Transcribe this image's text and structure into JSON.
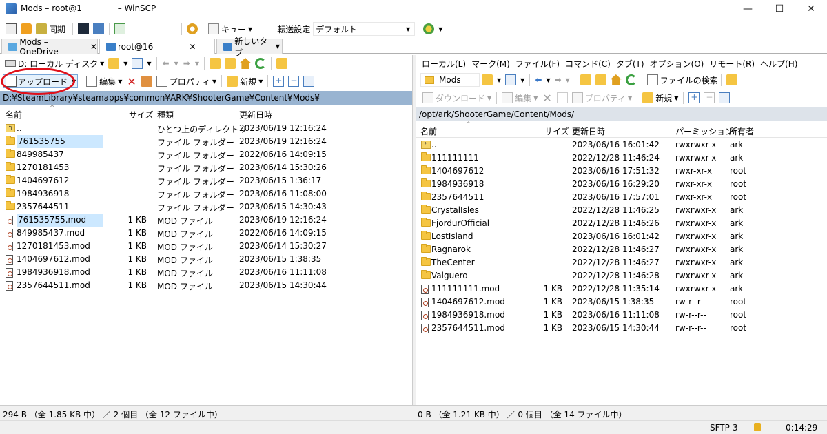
{
  "window": {
    "title": "Mods – root@1     – WinSCP"
  },
  "main_toolbar": {
    "sync_label": "同期",
    "queue_label": "キュー",
    "transfer_settings_label": "転送設定",
    "transfer_preset": "デフォルト"
  },
  "tabs": [
    {
      "label": "Mods – OneDrive"
    },
    {
      "label": "root@16    "
    },
    {
      "label": "新しいタブ"
    }
  ],
  "left": {
    "drive_label": "D: ローカル ディスク",
    "upload_label": "アップロード",
    "edit_label": "編集",
    "properties_label": "プロパティ",
    "new_label": "新規",
    "path": "D:¥SteamLibrary¥steamapps¥common¥ARK¥ShooterGame¥Content¥Mods¥",
    "columns": {
      "name": "名前",
      "size": "サイズ",
      "type": "種類",
      "modified": "更新日時"
    },
    "rows": [
      {
        "name": "..",
        "size": "",
        "type": "ひとつ上のディレクトリ",
        "modified": "2023/06/19 12:16:24",
        "kind": "up",
        "selected": false
      },
      {
        "name": "761535755",
        "size": "",
        "type": "ファイル フォルダー",
        "modified": "2023/06/19 12:16:24",
        "kind": "folder",
        "selected": true
      },
      {
        "name": "849985437",
        "size": "",
        "type": "ファイル フォルダー",
        "modified": "2022/06/16 14:09:15",
        "kind": "folder",
        "selected": false
      },
      {
        "name": "1270181453",
        "size": "",
        "type": "ファイル フォルダー",
        "modified": "2023/06/14 15:30:26",
        "kind": "folder",
        "selected": false
      },
      {
        "name": "1404697612",
        "size": "",
        "type": "ファイル フォルダー",
        "modified": "2023/06/15 1:36:17",
        "kind": "folder",
        "selected": false
      },
      {
        "name": "1984936918",
        "size": "",
        "type": "ファイル フォルダー",
        "modified": "2023/06/16 11:08:00",
        "kind": "folder",
        "selected": false
      },
      {
        "name": "2357644511",
        "size": "",
        "type": "ファイル フォルダー",
        "modified": "2023/06/15 14:30:43",
        "kind": "folder",
        "selected": false
      },
      {
        "name": "761535755.mod",
        "size": "1 KB",
        "type": "MOD ファイル",
        "modified": "2023/06/19 12:16:24",
        "kind": "file",
        "selected": true
      },
      {
        "name": "849985437.mod",
        "size": "1 KB",
        "type": "MOD ファイル",
        "modified": "2022/06/16 14:09:15",
        "kind": "file",
        "selected": false
      },
      {
        "name": "1270181453.mod",
        "size": "1 KB",
        "type": "MOD ファイル",
        "modified": "2023/06/14 15:30:27",
        "kind": "file",
        "selected": false
      },
      {
        "name": "1404697612.mod",
        "size": "1 KB",
        "type": "MOD ファイル",
        "modified": "2023/06/15 1:38:35",
        "kind": "file",
        "selected": false
      },
      {
        "name": "1984936918.mod",
        "size": "1 KB",
        "type": "MOD ファイル",
        "modified": "2023/06/16 11:11:08",
        "kind": "file",
        "selected": false
      },
      {
        "name": "2357644511.mod",
        "size": "1 KB",
        "type": "MOD ファイル",
        "modified": "2023/06/15 14:30:44",
        "kind": "file",
        "selected": false
      }
    ],
    "status": "294 B （全 1.85 KB 中） ／ 2 個目 （全 12 ファイル中）"
  },
  "right": {
    "menu": [
      "ローカル(L)",
      "マーク(M)",
      "ファイル(F)",
      "コマンド(C)",
      "タブ(T)",
      "オプション(O)",
      "リモート(R)",
      "ヘルプ(H)"
    ],
    "folder_label": "Mods",
    "find_label": "ファイルの検索",
    "download_label": "ダウンロード",
    "edit_label": "編集",
    "properties_label": "プロパティ",
    "new_label": "新規",
    "path": "/opt/ark/ShooterGame/Content/Mods/",
    "columns": {
      "name": "名前",
      "size": "サイズ",
      "modified": "更新日時",
      "permissions": "パーミッション",
      "owner": "所有者"
    },
    "rows": [
      {
        "name": "..",
        "size": "",
        "modified": "2023/06/16 16:01:42",
        "perm": "rwxrwxr-x",
        "owner": "ark",
        "kind": "up"
      },
      {
        "name": "111111111",
        "size": "",
        "modified": "2022/12/28 11:46:24",
        "perm": "rwxrwxr-x",
        "owner": "ark",
        "kind": "folder"
      },
      {
        "name": "1404697612",
        "size": "",
        "modified": "2023/06/16 17:51:32",
        "perm": "rwxr-xr-x",
        "owner": "root",
        "kind": "folder"
      },
      {
        "name": "1984936918",
        "size": "",
        "modified": "2023/06/16 16:29:20",
        "perm": "rwxr-xr-x",
        "owner": "root",
        "kind": "folder"
      },
      {
        "name": "2357644511",
        "size": "",
        "modified": "2023/06/16 17:57:01",
        "perm": "rwxr-xr-x",
        "owner": "root",
        "kind": "folder"
      },
      {
        "name": "CrystalIsles",
        "size": "",
        "modified": "2022/12/28 11:46:25",
        "perm": "rwxrwxr-x",
        "owner": "ark",
        "kind": "folder"
      },
      {
        "name": "FjordurOfficial",
        "size": "",
        "modified": "2022/12/28 11:46:26",
        "perm": "rwxrwxr-x",
        "owner": "ark",
        "kind": "folder"
      },
      {
        "name": "LostIsland",
        "size": "",
        "modified": "2023/06/16 16:01:42",
        "perm": "rwxrwxr-x",
        "owner": "ark",
        "kind": "folder"
      },
      {
        "name": "Ragnarok",
        "size": "",
        "modified": "2022/12/28 11:46:27",
        "perm": "rwxrwxr-x",
        "owner": "ark",
        "kind": "folder"
      },
      {
        "name": "TheCenter",
        "size": "",
        "modified": "2022/12/28 11:46:27",
        "perm": "rwxrwxr-x",
        "owner": "ark",
        "kind": "folder"
      },
      {
        "name": "Valguero",
        "size": "",
        "modified": "2022/12/28 11:46:28",
        "perm": "rwxrwxr-x",
        "owner": "ark",
        "kind": "folder"
      },
      {
        "name": "111111111.mod",
        "size": "1 KB",
        "modified": "2022/12/28 11:35:14",
        "perm": "rwxrwxr-x",
        "owner": "ark",
        "kind": "file"
      },
      {
        "name": "1404697612.mod",
        "size": "1 KB",
        "modified": "2023/06/15 1:38:35",
        "perm": "rw-r--r--",
        "owner": "root",
        "kind": "file"
      },
      {
        "name": "1984936918.mod",
        "size": "1 KB",
        "modified": "2023/06/16 11:11:08",
        "perm": "rw-r--r--",
        "owner": "root",
        "kind": "file"
      },
      {
        "name": "2357644511.mod",
        "size": "1 KB",
        "modified": "2023/06/15 14:30:44",
        "perm": "rw-r--r--",
        "owner": "root",
        "kind": "file"
      }
    ],
    "status": "0 B （全 1.21 KB 中） ／ 0 個目 （全 14 ファイル中）"
  },
  "bottom": {
    "protocol": "SFTP-3",
    "elapsed": "0:14:29"
  }
}
